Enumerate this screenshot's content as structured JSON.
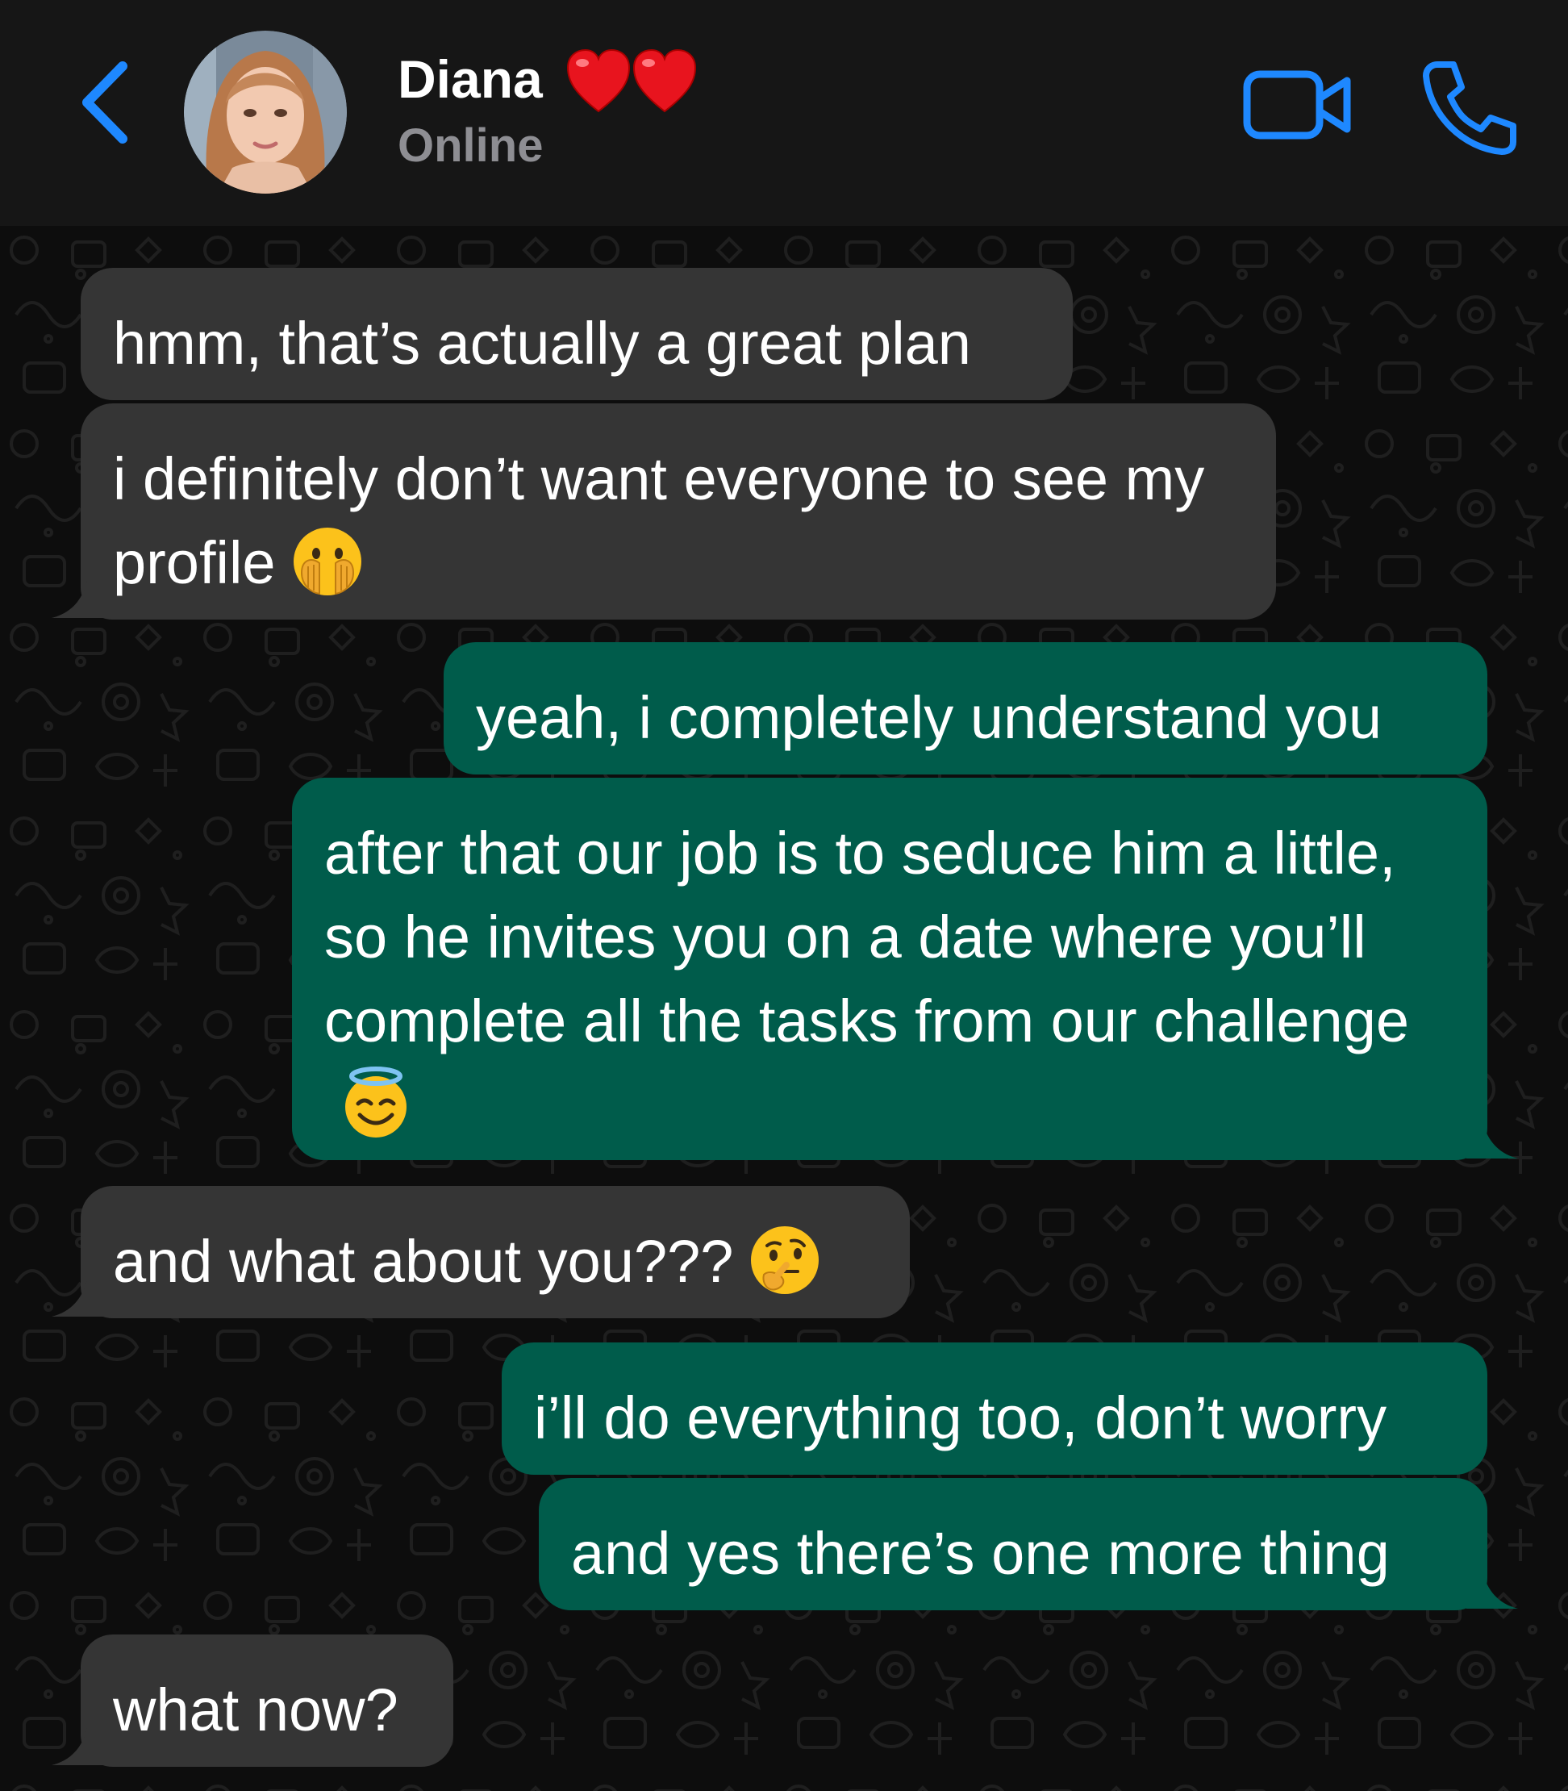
{
  "header": {
    "contact_name": "Diana",
    "status": "Online",
    "name_emoji": "two red hearts",
    "icons": {
      "back": "chevron-left-icon",
      "video": "video-camera-icon",
      "call": "phone-icon"
    },
    "accent_color": "#1E88FF"
  },
  "colors": {
    "incoming_bubble": "#353535",
    "outgoing_bubble": "#005C4B",
    "background": "#0D0D0D",
    "header_bg": "#161616"
  },
  "messages": [
    {
      "direction": "incoming",
      "text": "hmm, that’s actually a great plan"
    },
    {
      "direction": "incoming",
      "text": "i definitely don’t want everyone to see my profile",
      "emoji": "face-with-open-eyes-and-hand-over-mouth"
    },
    {
      "direction": "outgoing",
      "text": "yeah, i completely understand you"
    },
    {
      "direction": "outgoing",
      "text": "after that our job is to seduce him a little, so he invites you on a date where you’ll complete all the tasks from our challenge",
      "emoji": "smiling-face-with-halo"
    },
    {
      "direction": "incoming",
      "text": "and what about you???",
      "emoji": "thinking-face"
    },
    {
      "direction": "outgoing",
      "text": "i’ll do everything too, don’t worry"
    },
    {
      "direction": "outgoing",
      "text": "and yes there’s one more thing"
    },
    {
      "direction": "incoming",
      "text": "what now?"
    }
  ]
}
